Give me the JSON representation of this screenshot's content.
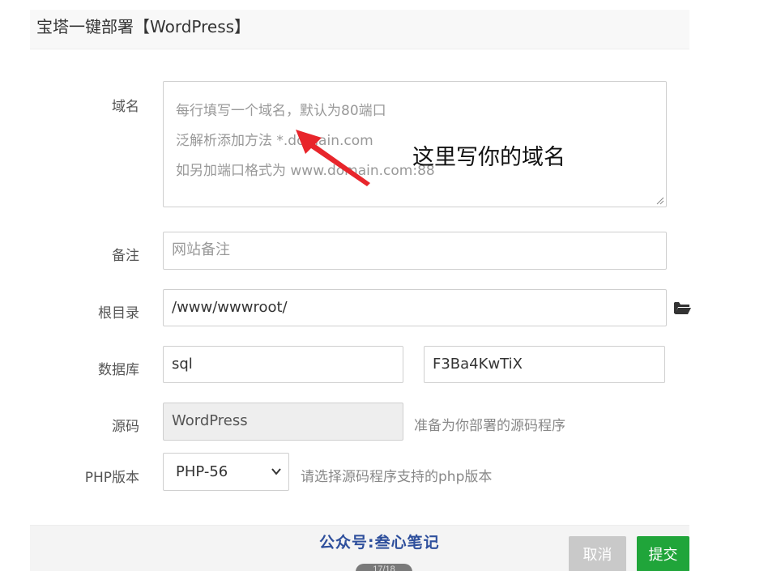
{
  "header": {
    "title": "宝塔一键部署【WordPress】"
  },
  "form": {
    "domain": {
      "label": "域名",
      "placeholder_lines": [
        "每行填写一个域名，默认为80端口",
        "泛解析添加方法 *.domain.com",
        "如另加端口格式为 www.domain.com:88"
      ]
    },
    "remark": {
      "label": "备注",
      "placeholder": "网站备注"
    },
    "root": {
      "label": "根目录",
      "value": "/www/wwwroot/",
      "browse_icon": "folder-open-icon"
    },
    "database": {
      "label": "数据库",
      "user": "sql",
      "password": "F3Ba4KwTiX"
    },
    "source": {
      "label": "源码",
      "value": "WordPress",
      "hint": "准备为你部署的源码程序"
    },
    "php": {
      "label": "PHP版本",
      "selected": "PHP-56",
      "hint": "请选择源码程序支持的php版本"
    }
  },
  "annotation": {
    "text": "这里写你的域名",
    "color": "#e8252b"
  },
  "footer": {
    "watermark": "公众号:叁心笔记",
    "cancel_label": "取消",
    "submit_label": "提交",
    "pager": "17/18"
  },
  "colors": {
    "submit": "#20a53a",
    "cancel": "#c9c9c9",
    "watermark": "#2e4f9c"
  }
}
